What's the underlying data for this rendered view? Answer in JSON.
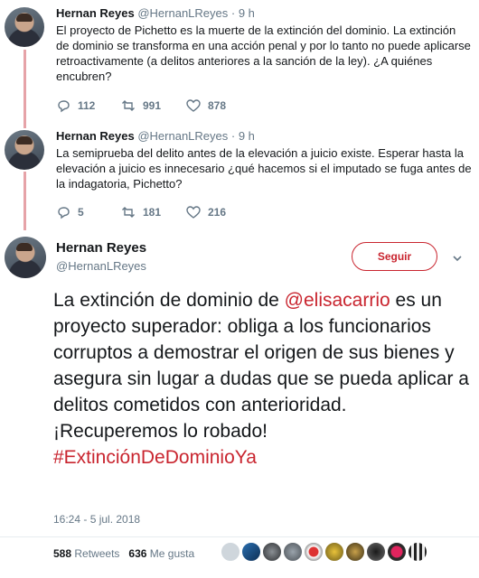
{
  "tweets": [
    {
      "name": "Hernan Reyes",
      "handle": "@HernanLReyes",
      "time": "· 9 h",
      "text": "El proyecto de Pichetto es la muerte de la extinción del dominio. La extinción de dominio se transforma en una acción penal y por lo tanto no puede aplicarse retroactivamente (a delitos anteriores a la sanción de la ley). ¿A quiénes encubren?",
      "replies": "112",
      "retweets": "991",
      "likes": "878"
    },
    {
      "name": "Hernan Reyes",
      "handle": "@HernanLReyes",
      "time": "· 9 h",
      "text": "La semiprueba del delito antes de la elevación a juicio existe. Esperar hasta la elevación a juicio es innecesario ¿qué hacemos si el imputado se fuga antes de la indagatoria, Pichetto?",
      "replies": "5",
      "retweets": "181",
      "likes": "216"
    }
  ],
  "main": {
    "name": "Hernan Reyes",
    "handle": "@HernanLReyes",
    "follow_label": "Seguir",
    "text_before": "La extinción de dominio de ",
    "mention": "@elisacarrio",
    "text_after": " es un proyecto superador: obliga a los funcionarios corruptos a demostrar el origen de sus bienes y asegura sin lugar a dudas que se pueda aplicar a delitos cometidos con anterioridad. ¡Recuperemos lo robado!",
    "hashtag": "#ExtinciónDeDominioYa",
    "timestamp": "16:24 - 5 jul. 2018",
    "retweet_count": "588",
    "retweet_label": "Retweets",
    "like_count": "636",
    "like_label": "Me gusta"
  },
  "colors": {
    "accent": "#c9252f",
    "thread_line": "#e6a3a8",
    "muted": "#657786"
  },
  "likers_icons": [
    "liker-avatar",
    "liker-avatar",
    "liker-avatar",
    "liker-avatar",
    "liker-avatar",
    "liker-avatar",
    "liker-avatar",
    "liker-avatar",
    "liker-avatar",
    "liker-avatar"
  ]
}
